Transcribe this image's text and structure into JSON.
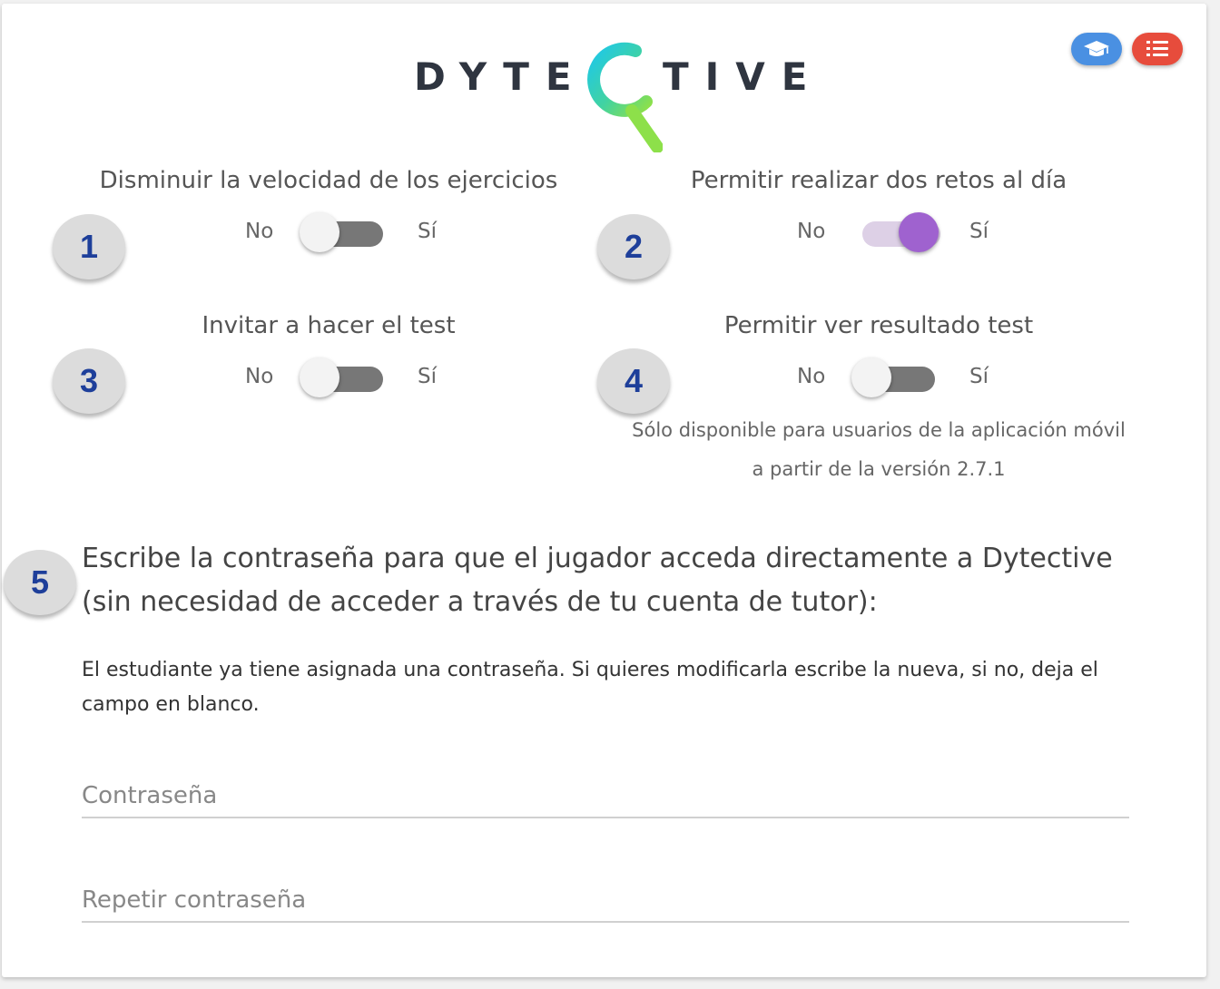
{
  "header": {
    "logo_left": "DYTE",
    "logo_right": "TIVE",
    "colors": {
      "tutor_button": "#4a90e2",
      "list_button": "#e74c3c",
      "accent_purple": "#9f62cf"
    }
  },
  "settings": [
    {
      "number": "1",
      "label": "Disminuir la velocidad de los ejercicios",
      "no": "No",
      "yes": "Sí",
      "enabled": false
    },
    {
      "number": "2",
      "label": "Permitir realizar dos retos al día",
      "no": "No",
      "yes": "Sí",
      "enabled": true
    },
    {
      "number": "3",
      "label": "Invitar a hacer el test",
      "no": "No",
      "yes": "Sí",
      "enabled": false
    },
    {
      "number": "4",
      "label": "Permitir ver resultado test",
      "no": "No",
      "yes": "Sí",
      "enabled": false,
      "note_line1": "Sólo disponible para usuarios de la aplicación móvil",
      "note_line2": "a partir de la versión 2.7.1"
    }
  ],
  "password": {
    "number": "5",
    "question": "Escribe la contraseña para que el jugador acceda directamente a Dytective (sin necesidad de acceder a través de tu cuenta de tutor):",
    "info": "El estudiante ya tiene asignada una contraseña. Si quieres modificarla escribe la nueva, si no, deja el campo en blanco.",
    "field1_placeholder": "Contraseña",
    "field2_placeholder": "Repetir contraseña"
  }
}
